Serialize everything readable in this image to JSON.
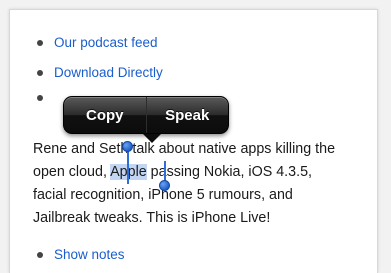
{
  "links_top": [
    {
      "label": "Our podcast feed"
    },
    {
      "label": "Download Directly"
    }
  ],
  "callout": {
    "copy_label": "Copy",
    "speak_label": "Speak"
  },
  "paragraph": {
    "line1": "Rene and Seth talk about native apps killing the",
    "line2_before": "open cloud, ",
    "line2_selected": "Apple",
    "line2_after": " passing Nokia, iOS 4.3.5,",
    "line3": "facial recognition, iPhone 5 rumours, and",
    "line4": "Jailbreak tweaks. This is iPhone Live!"
  },
  "links_bottom": [
    {
      "label": "Show notes"
    }
  ],
  "colors": {
    "link": "#1a5ecc",
    "selection": "#78a5e6",
    "handle": "#2d6fd6"
  }
}
